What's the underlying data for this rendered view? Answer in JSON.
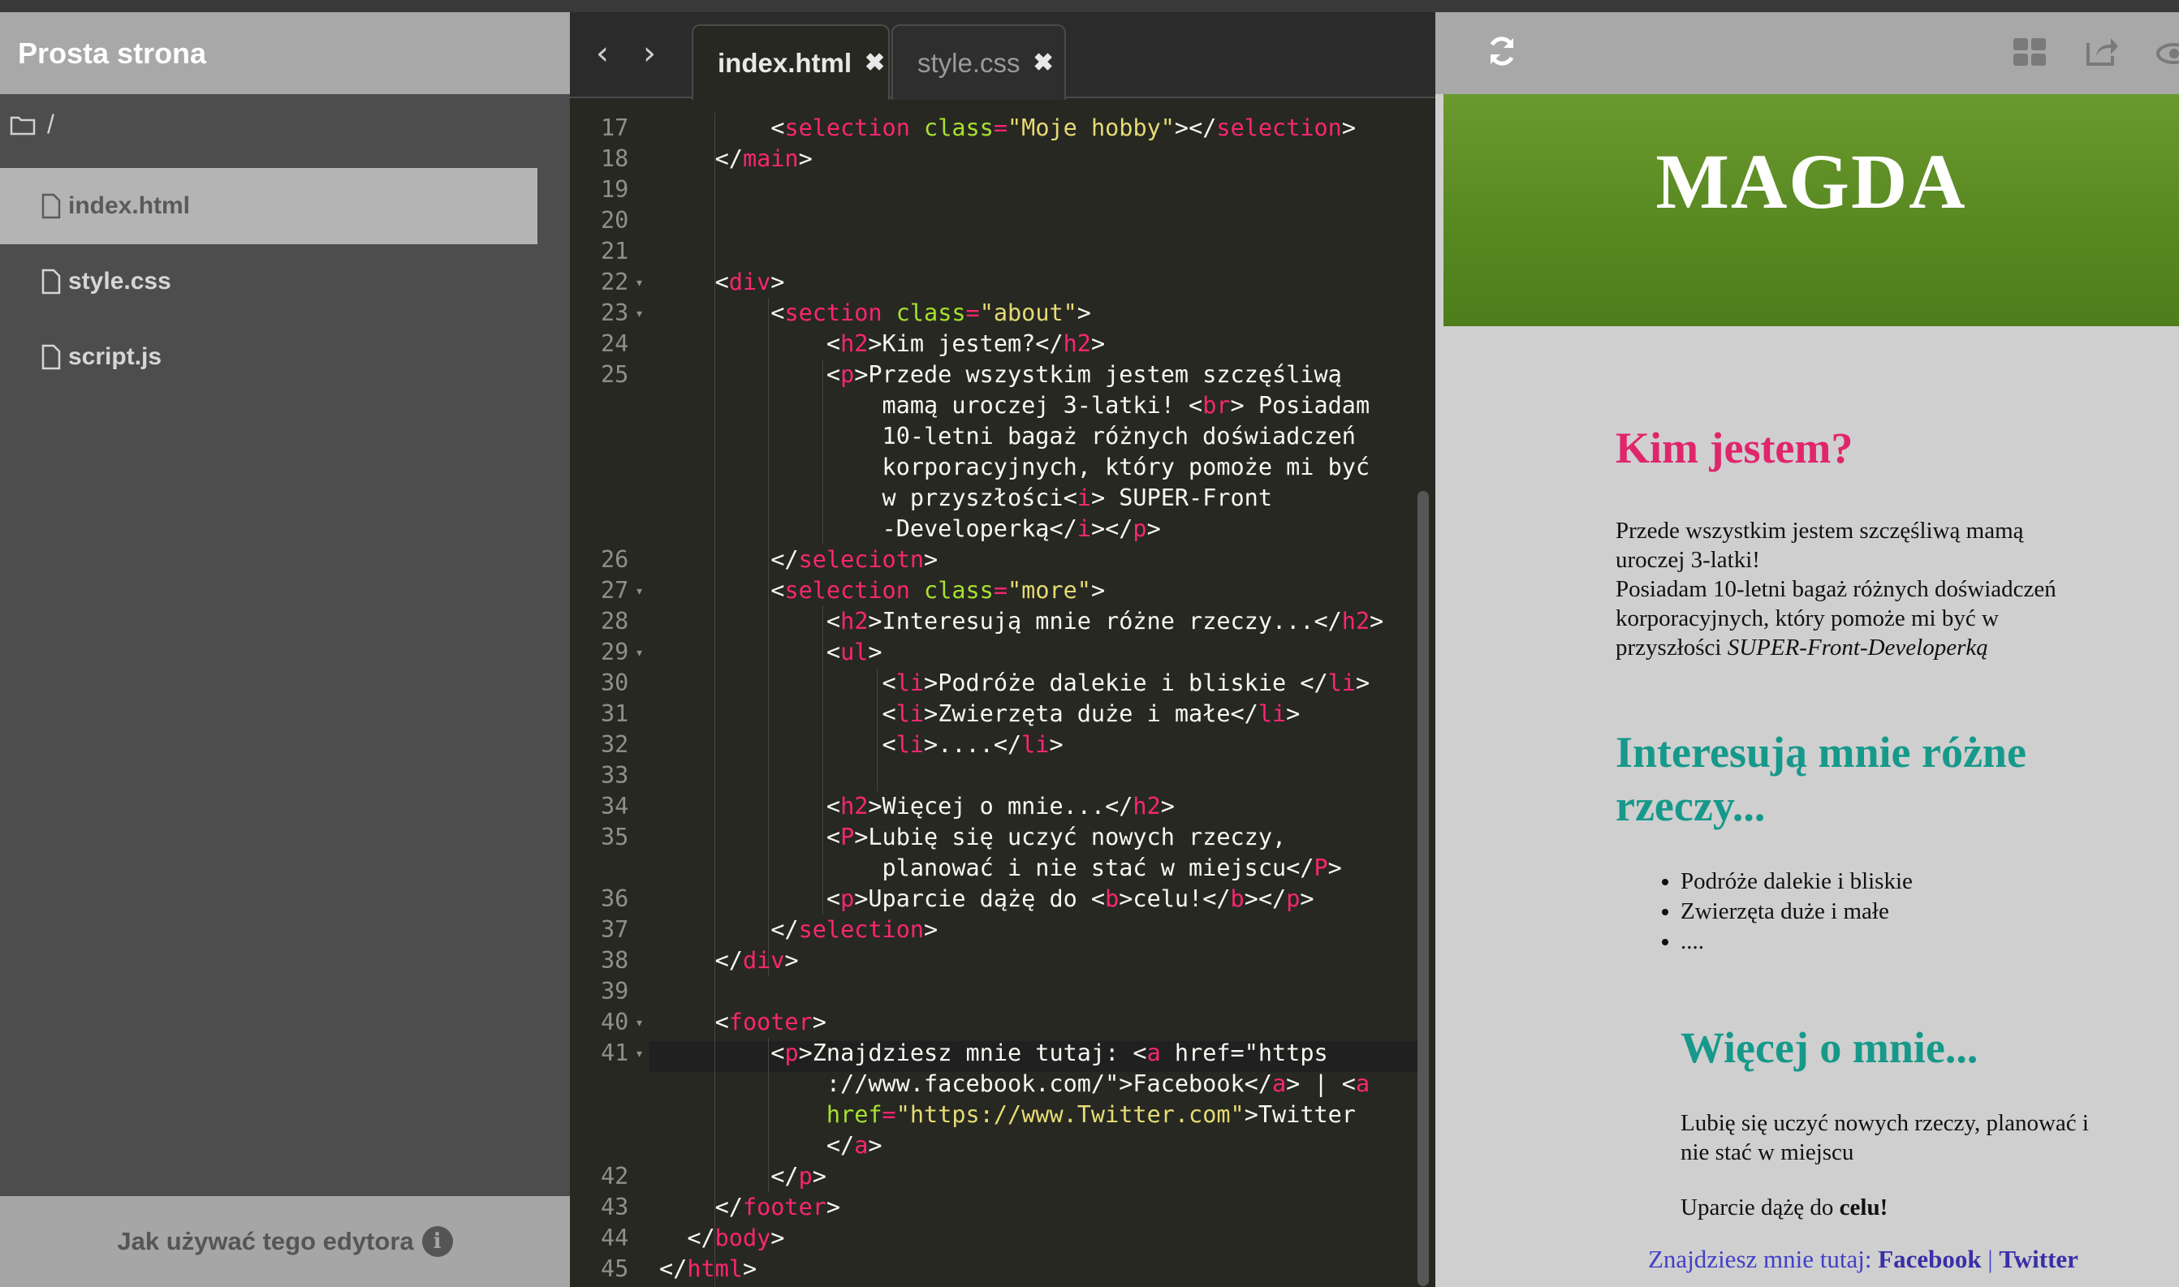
{
  "sidebar": {
    "title": "Prosta strona",
    "folder": "/",
    "files": [
      {
        "label": "index.html"
      },
      {
        "label": "style.css"
      },
      {
        "label": "script.js"
      }
    ],
    "help": "Jak używać tego edytora"
  },
  "editor": {
    "tabs": [
      {
        "label": "index.html",
        "close": "✖"
      },
      {
        "label": "style.css",
        "close": "✖"
      }
    ],
    "lines": [
      {
        "n": "17",
        "fold": false
      },
      {
        "n": "18",
        "fold": false
      },
      {
        "n": "19",
        "fold": false
      },
      {
        "n": "20",
        "fold": false
      },
      {
        "n": "21",
        "fold": false
      },
      {
        "n": "22",
        "fold": true
      },
      {
        "n": "23",
        "fold": true
      },
      {
        "n": "24",
        "fold": false
      },
      {
        "n": "25",
        "fold": false
      },
      {
        "n": "26",
        "fold": false
      },
      {
        "n": "27",
        "fold": true
      },
      {
        "n": "28",
        "fold": false
      },
      {
        "n": "29",
        "fold": true
      },
      {
        "n": "30",
        "fold": false
      },
      {
        "n": "31",
        "fold": false
      },
      {
        "n": "32",
        "fold": false
      },
      {
        "n": "33",
        "fold": false
      },
      {
        "n": "34",
        "fold": false
      },
      {
        "n": "35",
        "fold": false
      },
      {
        "n": "36",
        "fold": false
      },
      {
        "n": "37",
        "fold": false
      },
      {
        "n": "38",
        "fold": false
      },
      {
        "n": "39",
        "fold": false
      },
      {
        "n": "40",
        "fold": true
      },
      {
        "n": "41",
        "fold": true
      },
      {
        "n": "42",
        "fold": false
      },
      {
        "n": "43",
        "fold": false
      },
      {
        "n": "44",
        "fold": false
      },
      {
        "n": "45",
        "fold": false
      }
    ],
    "code": [
      "        <selection class=\"Moje hobby\"></selection>",
      "    </main>",
      "",
      "",
      "",
      "    <div>",
      "        <section class=\"about\">",
      "            <h2>Kim jestem?</h2>",
      "            <p>Przede wszystkim jestem szczęśliwą",
      "                mamą uroczej 3-latki! <br> Posiadam",
      "                10-letni bagaż różnych doświadczeń",
      "                korporacyjnych, który pomoże mi być",
      "                w przyszłości<i> SUPER-Front",
      "                -Developerką</i></p>",
      "        </seleciotn>",
      "        <selection class=\"more\">",
      "            <h2>Interesują mnie różne rzeczy...</h2>",
      "            <ul>",
      "                <li>Podróże dalekie i bliskie </li>",
      "                <li>Zwierzęta duże i małe</li>",
      "                <li>....</li>",
      "",
      "            <h2>Więcej o mnie...</h2>",
      "            <P>Lubię się uczyć nowych rzeczy,",
      "                planować i nie stać w miejscu</P>",
      "            <p>Uparcie dążę do <b>celu!</b></p>",
      "        </selection>",
      "    </div>",
      "",
      "    <footer>",
      "        <p>Znajdziesz mnie tutaj: <a href=\"https",
      "            ://www.facebook.com/\">Facebook</a> | <a",
      "            href=\"https://www.Twitter.com\">Twitter",
      "            </a>",
      "        </p>",
      "    </footer>",
      "  </body>",
      "</html>"
    ]
  },
  "preview": {
    "name": "MAGDA",
    "h_about": "Kim jestem?",
    "about_1": "Przede wszystkim jestem szczęśliwą mamą",
    "about_2": "uroczej 3-latki!",
    "about_3": "Posiadam 10-letni bagaż różnych doświadczeń",
    "about_4": "korporacyjnych, który pomoże mi być w",
    "about_5a": "przyszłości ",
    "about_5b": "SUPER-Front-Developerką",
    "h_more_1": "Interesują mnie różne",
    "h_more_2": "rzeczy...",
    "list": [
      "Podróże dalekie i bliskie",
      "Zwierzęta duże i małe",
      "...."
    ],
    "h_more_me": "Więcej o mnie...",
    "learn_1": "Lubię się uczyć nowych rzeczy, planować i",
    "learn_2": "nie stać w miejscu",
    "goal_a": "Uparcie dążę do ",
    "goal_b": "celu!",
    "footer_text": "Znajdziesz mnie tutaj: ",
    "footer_fb": "Facebook",
    "footer_sep": " | ",
    "footer_tw": "Twitter"
  },
  "icons": {
    "refresh": "refresh-icon",
    "grid": "grid-icon",
    "share": "share-icon",
    "eye": "eye-icon"
  }
}
